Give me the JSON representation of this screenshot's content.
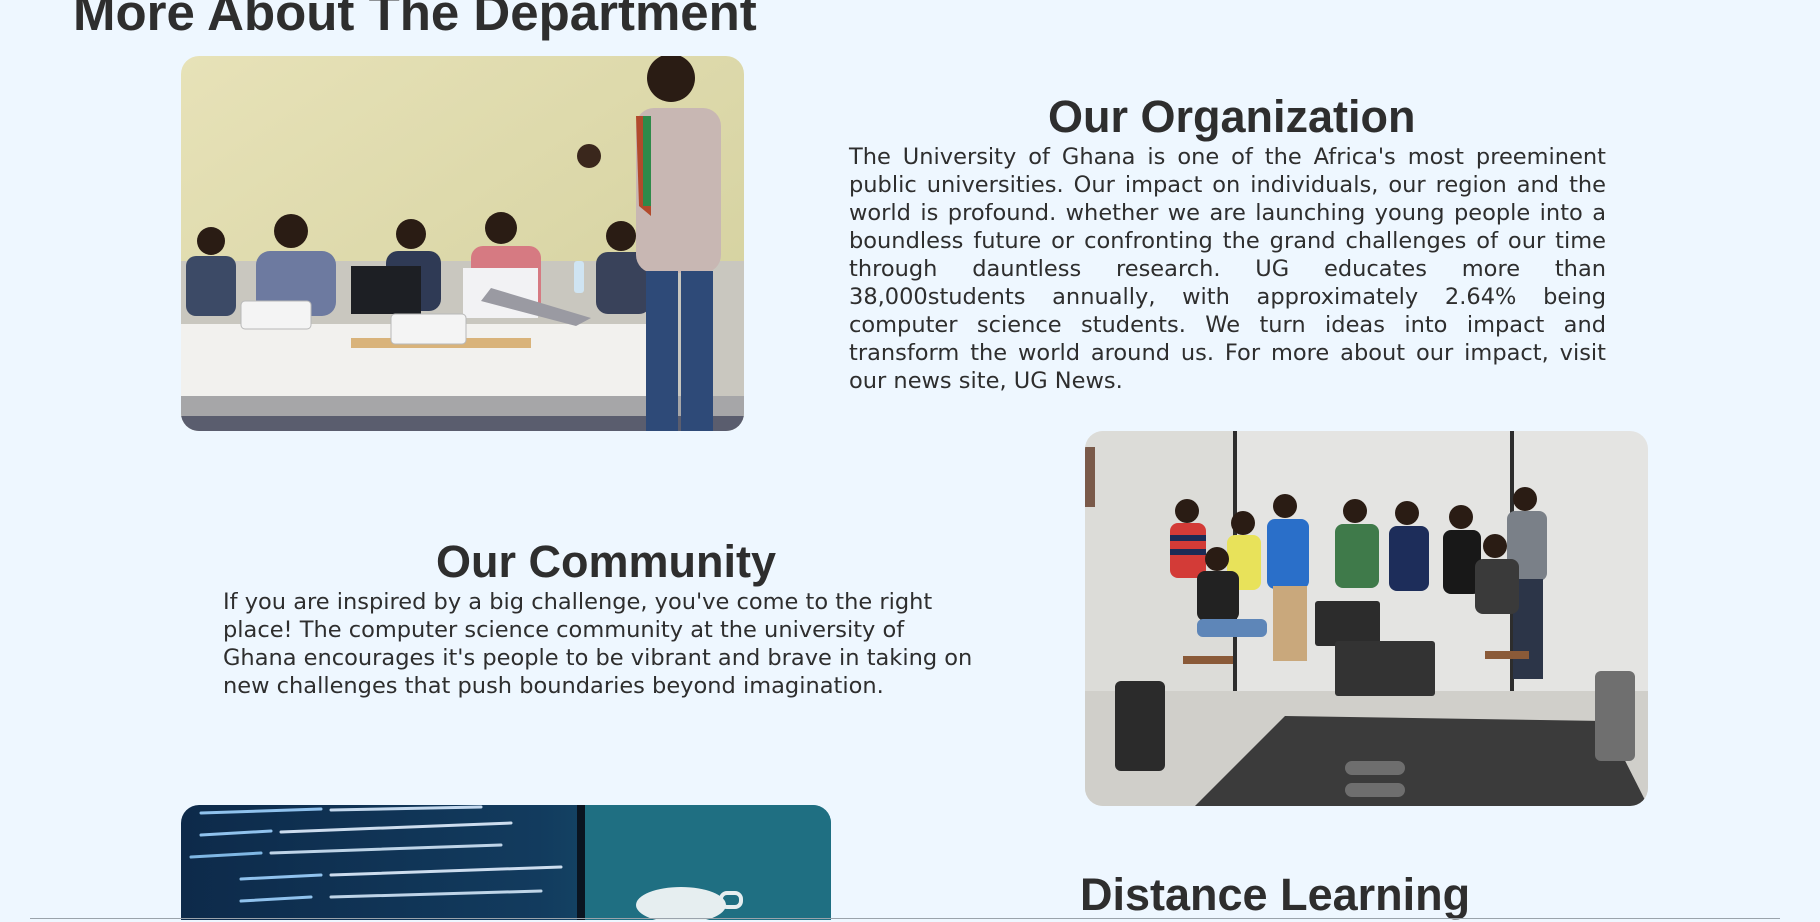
{
  "page": {
    "heading": "More About The Department"
  },
  "sections": {
    "organization": {
      "title": "Our Organization",
      "text": "The University of Ghana is one of the Africa's most preeminent public universities. Our impact on individuals, our region and the world is profound. whether we are launching young people into a boundless future or confronting the grand challenges of our time through dauntless research. UG educates more than 38,000students annually, with approximately 2.64% being computer science students. We turn ideas into impact and transform the world around us. For more about our impact, visit our news site, UG News.",
      "image_alt": "Lecturer teaching a class of students with laptops"
    },
    "community": {
      "title": "Our Community",
      "text": "If you are inspired by a big challenge, you've come to the right place! The computer science community at the university of Ghana encourages it's people to be vibrant and brave in taking on new challenges that push boundaries beyond imagination.",
      "image_alt": "Group of students posing in a computer lab"
    },
    "distance_learning": {
      "title": "Distance Learning",
      "image_alt": "Close-up of HTML code on a monitor"
    }
  },
  "colors": {
    "background": "#eef7ff",
    "text": "#2e2e2e"
  }
}
